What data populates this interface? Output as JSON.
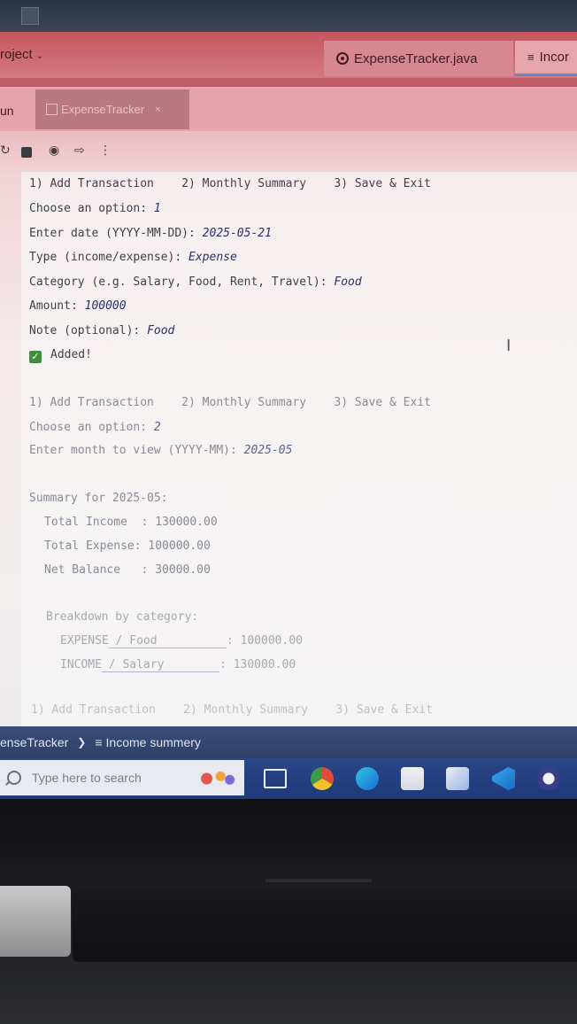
{
  "ide": {
    "project_label": "roject",
    "tabs": [
      {
        "label": "ExpenseTracker.java"
      },
      {
        "label": "Incor"
      }
    ],
    "run_label": "un",
    "run_tab_label": "ExpenseTracker",
    "run_tab_close": "×"
  },
  "console": {
    "block1": {
      "menu": "1) Add Transaction    2) Monthly Summary    3) Save & Exit",
      "choose_prompt": "Choose an option: ",
      "choose_value": "1",
      "date_prompt": "Enter date (YYYY-MM-DD): ",
      "date_value": "2025-05-21",
      "type_prompt": "Type (income/expense): ",
      "type_value": "Expense",
      "category_prompt": "Category (e.g. Salary, Food, Rent, Travel): ",
      "category_value": "Food",
      "amount_prompt": "Amount: ",
      "amount_value": "100000",
      "note_prompt": "Note (optional): ",
      "note_value": "Food",
      "added_text": "Added!"
    },
    "block2": {
      "menu": "1) Add Transaction    2) Monthly Summary    3) Save & Exit",
      "choose_prompt": "Choose an option: ",
      "choose_value": "2",
      "month_prompt": "Enter month to view (YYYY-MM): ",
      "month_value": "2025-05"
    },
    "summary": {
      "header": "Summary for 2025-05:",
      "income_line": "Total Income  : 130000.00",
      "expense_line": "Total Expense: 100000.00",
      "balance_line": "Net Balance   : 30000.00",
      "breakdown_header": "Breakdown by category:",
      "rows": [
        {
          "type": "EXPENSE",
          "sep": " / ",
          "category": "Food",
          "pad": "          ",
          "amount": ": 100000.00"
        },
        {
          "type": "INCOME",
          "sep": " / ",
          "category": "Salary",
          "pad": "        ",
          "amount": ": 130000.00"
        }
      ]
    },
    "cutoff_menu": "1) Add Transaction    2) Monthly Summary    3) Save & Exit"
  },
  "statusbar": {
    "crumb1": "enseTracker",
    "crumb2": "Income summery"
  },
  "taskbar": {
    "search_placeholder": "Type here to search"
  }
}
